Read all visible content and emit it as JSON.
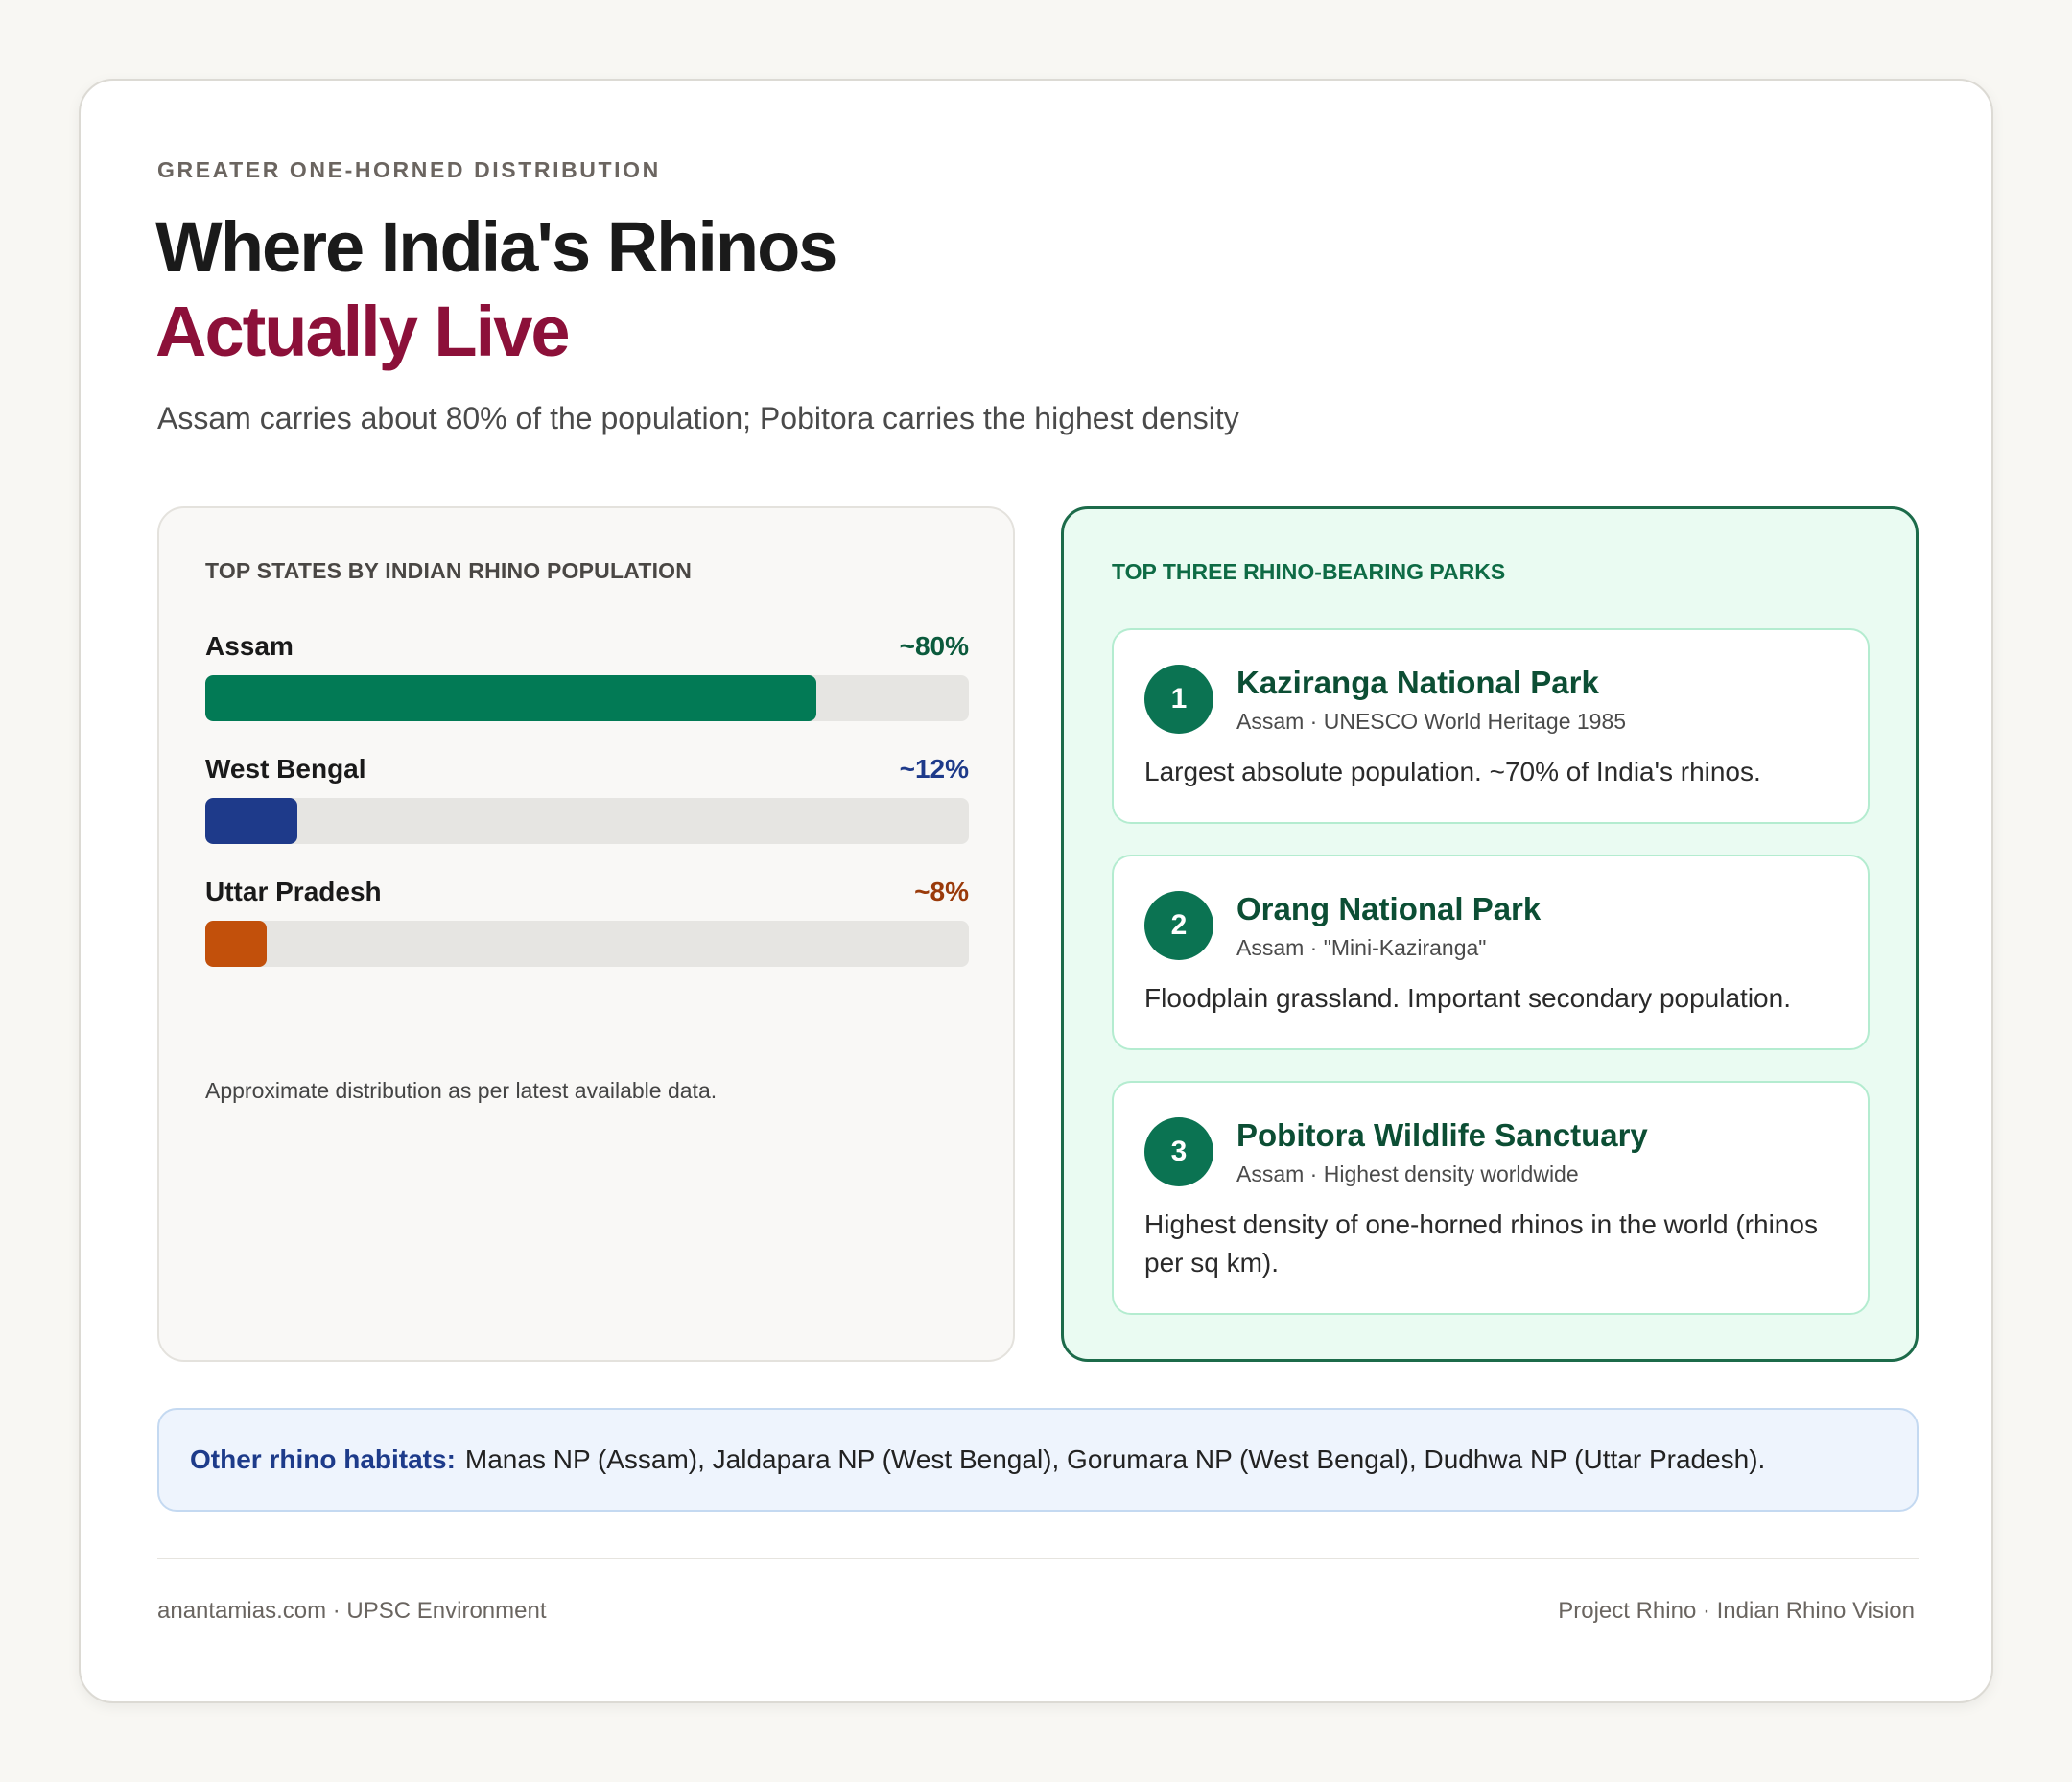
{
  "header": {
    "eyebrow": "GREATER ONE-HORNED DISTRIBUTION",
    "title_line1": "Where India's Rhinos",
    "title_line2": "Actually Live",
    "subtitle": "Assam carries about 80% of the population; Pobitora carries the highest density"
  },
  "states_panel": {
    "heading": "TOP STATES BY INDIAN RHINO POPULATION",
    "items": [
      {
        "label": "Assam",
        "pct_label": "~80%",
        "share": 0.8,
        "color": "#027a55",
        "text_color": "#0b5a3c"
      },
      {
        "label": "West Bengal",
        "pct_label": "~12%",
        "share": 0.12,
        "color": "#1e3a8a",
        "text_color": "#1e3a8a"
      },
      {
        "label": "Uttar Pradesh",
        "pct_label": "~8%",
        "share": 0.08,
        "color": "#c2500b",
        "text_color": "#9a3a0a"
      }
    ],
    "note": "Approximate distribution as per latest available data."
  },
  "parks_panel": {
    "heading": "TOP THREE RHINO-BEARING PARKS",
    "parks": [
      {
        "rank": "1",
        "name": "Kaziranga National Park",
        "meta": "Assam · UNESCO World Heritage 1985",
        "desc": "Largest absolute population. ~70% of India's rhinos."
      },
      {
        "rank": "2",
        "name": "Orang National Park",
        "meta": "Assam · \"Mini-Kaziranga\"",
        "desc": "Floodplain grassland. Important secondary population."
      },
      {
        "rank": "3",
        "name": "Pobitora Wildlife Sanctuary",
        "meta": "Assam · Highest density worldwide",
        "desc": "Highest density of one-horned rhinos in the world (rhinos per sq km)."
      }
    ]
  },
  "other_habitats": {
    "label": "Other rhino habitats:",
    "text": "Manas NP (Assam), Jaldapara NP (West Bengal), Gorumara NP (West Bengal), Dudhwa NP (Uttar Pradesh)."
  },
  "footer": {
    "left": "anantamias.com · UPSC Environment",
    "right": "Project Rhino · Indian Rhino Vision"
  }
}
